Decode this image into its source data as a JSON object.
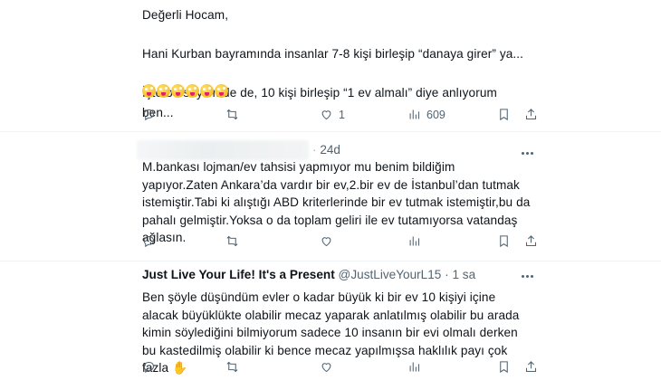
{
  "tweets": [
    {
      "body": "Değerli Hocam,\n\nHani Kurban bayramında insanlar 7-8 kişi birleşip “danaya girer” ya...\n\nİşte bu söylemde de, 10 kişi birleşip “1 ev almalı” diye anlıyorum ben...",
      "emoji_icon": "winking-face-with-tongue-icon",
      "emoji_count": 6,
      "actions": {
        "replies": "",
        "retweets": "",
        "likes": "1",
        "views": "609"
      }
    },
    {
      "meta_sep": "·",
      "time": "24d",
      "body": "M.bankası lojman/ev tahsisi yapmıyor mu benim bildiğim yapıyor.Zaten Ankara’da vardır bir ev,2.bir ev de İstanbul’dan tutmak istemiştir.Tabi ki alıştığı ABD kriterlerinde bir ev tutmak istemiştir,bu da pahalı gelmiştir.Yoksa o da toplam geliri ile ev tutamıyorsa vatandaş ağlasın.",
      "actions": {
        "replies": "",
        "retweets": "",
        "likes": "",
        "views": ""
      }
    },
    {
      "name": "Just Live Your Life! It's a Present",
      "handle": "@JustLiveYourL15",
      "sep": "·",
      "time": "1 sa",
      "body": "Ben şöyle düşündüm evler o kadar büyük ki bir ev 10 kişiyi içine alacak büyüklükte olabilir mecaz yaparak anlatılmış olabilir bu arada kimin söylediğini bilmiyorum sadece 10 insanın bir evi olmalı derken bu kastedilmiş olabilir ki bence mecaz yapılmışsa haklılık payı çok fazla ✋",
      "actions": {
        "replies": "",
        "retweets": "",
        "likes": "",
        "views": ""
      }
    }
  ],
  "icons": {
    "reply": "reply-icon",
    "retweet": "retweet-icon",
    "like": "heart-icon",
    "views": "views-chart-icon",
    "bookmark": "bookmark-icon",
    "share": "share-icon",
    "more": "more-dots-icon"
  }
}
